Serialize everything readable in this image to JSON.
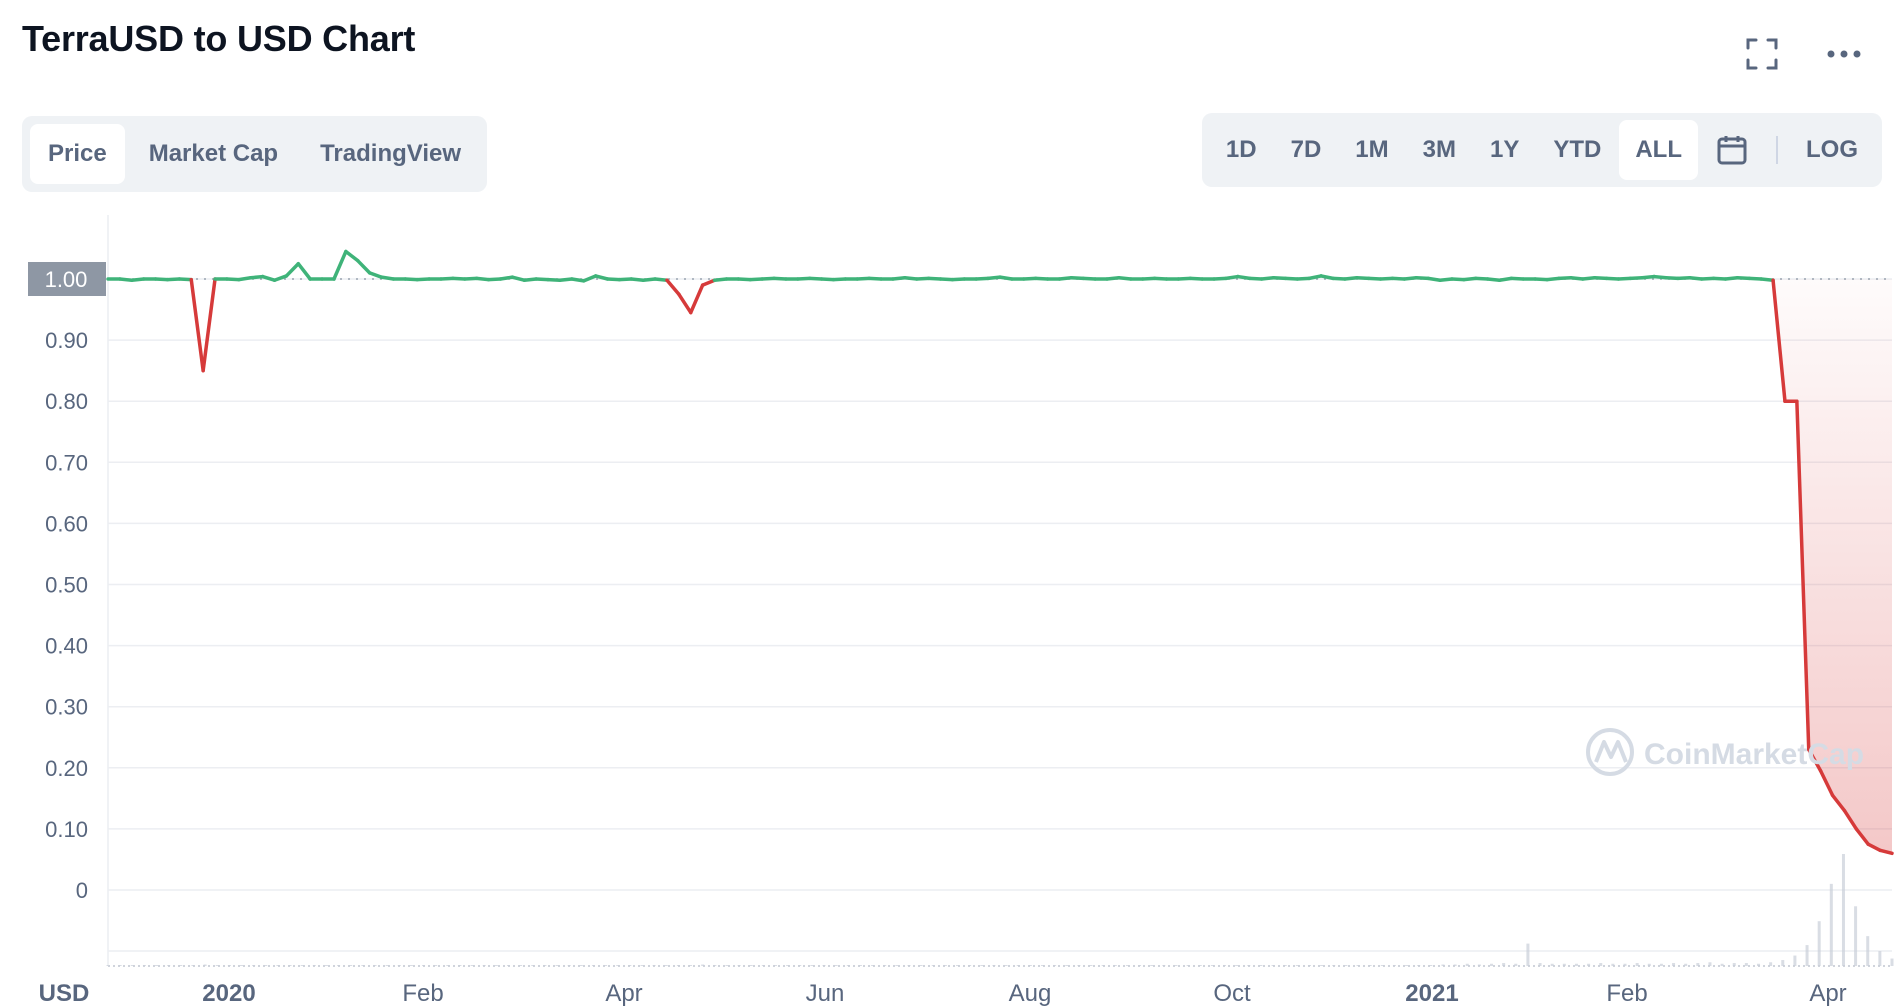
{
  "header": {
    "title": "TerraUSD to USD Chart",
    "fullscreen_icon": "expand-icon",
    "more_icon": "more-horizontal-icon"
  },
  "view_tabs": [
    {
      "label": "Price",
      "active": true
    },
    {
      "label": "Market Cap",
      "active": false
    },
    {
      "label": "TradingView",
      "active": false
    }
  ],
  "range_tabs": [
    {
      "label": "1D",
      "active": false
    },
    {
      "label": "7D",
      "active": false
    },
    {
      "label": "1M",
      "active": false
    },
    {
      "label": "3M",
      "active": false
    },
    {
      "label": "1Y",
      "active": false
    },
    {
      "label": "YTD",
      "active": false
    },
    {
      "label": "ALL",
      "active": true
    }
  ],
  "calendar_icon": "calendar-icon",
  "log_label": "LOG",
  "watermark": "CoinMarketCap",
  "colors": {
    "up": "#3fb379",
    "down": "#d63a3a",
    "grid": "#eceef2",
    "axis_text": "#58667e",
    "highlight_label_bg": "#8e97a4"
  },
  "chart_data": {
    "type": "line",
    "ylabel": "USD",
    "ylim": [
      0,
      1.0
    ],
    "y_ticks": [
      "1.00",
      "0.90",
      "0.80",
      "0.70",
      "0.60",
      "0.50",
      "0.40",
      "0.30",
      "0.20",
      "0.10",
      "0"
    ],
    "highlight_tick": "1.00",
    "x_ticks": [
      "2020",
      "Feb",
      "Apr",
      "Jun",
      "Aug",
      "Oct",
      "2021",
      "Feb",
      "Apr"
    ],
    "bold_x_ticks": [
      "2020",
      "2021"
    ],
    "baseline": 1.0,
    "series": [
      {
        "values": [
          1.0,
          1.0,
          0.998,
          1.0,
          1.0,
          0.999,
          1.0,
          0.999,
          0.85,
          1.0,
          1.0,
          0.999,
          1.002,
          1.004,
          0.998,
          1.005,
          1.025,
          1.0,
          1.0,
          1.0,
          1.045,
          1.03,
          1.01,
          1.003,
          1.0,
          1.0,
          0.999,
          1.0,
          1.0,
          1.001,
          1.0,
          1.001,
          0.999,
          1.0,
          1.003,
          0.998,
          1.0,
          0.999,
          0.998,
          1.0,
          0.997,
          1.005,
          1.0,
          0.999,
          1.0,
          0.998,
          1.0,
          0.998,
          0.975,
          0.945,
          0.99,
          0.998,
          1.0,
          1.0,
          0.999,
          1.0,
          1.001,
          1.0,
          1.0,
          1.001,
          1.0,
          0.999,
          1.0,
          1.0,
          1.001,
          1.0,
          1.0,
          1.002,
          1.0,
          1.001,
          1.0,
          0.999,
          1.0,
          1.0,
          1.001,
          1.003,
          1.0,
          1.0,
          1.001,
          1.0,
          1.0,
          1.002,
          1.001,
          1.0,
          1.0,
          1.002,
          1.0,
          1.0,
          1.001,
          1.0,
          1.0,
          1.001,
          1.0,
          1.0,
          1.001,
          1.004,
          1.001,
          1.0,
          1.002,
          1.001,
          1.0,
          1.001,
          1.005,
          1.001,
          1.0,
          1.002,
          1.001,
          1.0,
          1.001,
          1.0,
          1.002,
          1.001,
          0.998,
          1.0,
          0.999,
          1.001,
          1.0,
          0.998,
          1.001,
          1.0,
          1.0,
          0.999,
          1.001,
          1.002,
          1.0,
          1.002,
          1.001,
          1.0,
          1.001,
          1.002,
          1.004,
          1.002,
          1.001,
          1.002,
          1.0,
          1.001,
          1.0,
          1.002,
          1.001,
          1.0,
          0.998,
          0.8,
          0.8,
          0.23,
          0.195,
          0.155,
          0.13,
          0.1,
          0.075,
          0.065,
          0.06
        ]
      }
    ],
    "volume_note": "volume bars shown at bottom of plot",
    "volume": [
      1,
      1,
      1,
      1,
      1,
      1,
      1,
      1,
      2,
      1,
      1,
      1,
      1,
      1,
      1,
      1,
      1,
      1,
      1,
      1,
      1,
      1,
      1,
      1,
      1,
      1,
      1,
      1,
      1,
      1,
      1,
      1,
      1,
      1,
      1,
      1,
      1,
      1,
      1,
      1,
      1,
      1,
      1,
      1,
      1,
      1,
      1,
      1,
      1,
      2,
      1,
      1,
      1,
      1,
      1,
      1,
      1,
      1,
      1,
      1,
      1,
      1,
      1,
      1,
      1,
      1,
      1,
      1,
      1,
      1,
      1,
      1,
      1,
      1,
      1,
      1,
      1,
      1,
      1,
      1,
      1,
      1,
      1,
      1,
      1,
      1,
      1,
      1,
      1,
      1,
      1,
      1,
      1,
      1,
      1,
      1,
      1,
      1,
      1,
      1,
      1,
      1,
      1,
      1,
      1,
      1,
      1,
      1,
      1,
      1,
      2,
      2,
      3,
      2,
      3,
      4,
      3,
      30,
      4,
      3,
      3,
      3,
      3,
      4,
      3,
      3,
      4,
      3,
      3,
      4,
      3,
      4,
      5,
      3,
      4,
      4,
      3,
      5,
      8,
      14,
      28,
      60,
      110,
      150,
      80,
      40,
      20,
      10
    ]
  }
}
